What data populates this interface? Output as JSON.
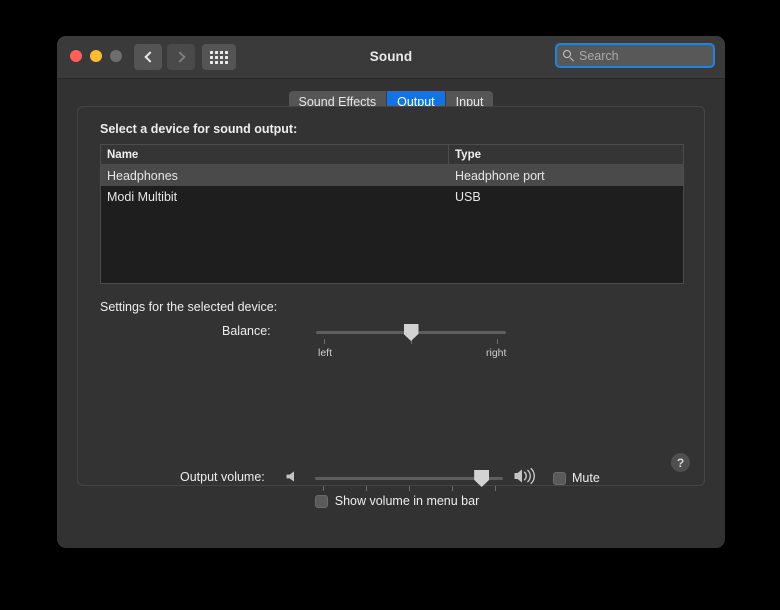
{
  "window": {
    "title": "Sound",
    "traffic_lights": [
      "close",
      "minimize",
      "zoom"
    ],
    "nav_back": "back-chevron",
    "nav_forward": "forward-chevron",
    "grid_button": "show-all-icon"
  },
  "search": {
    "placeholder": "Search",
    "value": "",
    "icon": "search-icon",
    "focus_color": "#1f84e0"
  },
  "tabs": [
    {
      "label": "Sound Effects",
      "active": false
    },
    {
      "label": "Output",
      "active": true
    },
    {
      "label": "Input",
      "active": false
    }
  ],
  "accent_color": "#1273e4",
  "device_section": {
    "label": "Select a device for sound output:",
    "columns": [
      "Name",
      "Type"
    ],
    "rows": [
      {
        "name": "Headphones",
        "type": "Headphone port",
        "selected": true
      },
      {
        "name": "Modi Multibit",
        "type": "USB",
        "selected": false
      }
    ]
  },
  "settings_section": {
    "label": "Settings for the selected device:",
    "balance": {
      "label": "Balance:",
      "left_label": "left",
      "right_label": "right",
      "value_percent": 50
    },
    "help_button": "?"
  },
  "output_volume": {
    "label": "Output volume:",
    "low_icon": "speaker-low-icon",
    "high_icon": "speaker-high-icon",
    "value_percent": 92,
    "mute": {
      "label": "Mute",
      "checked": false
    }
  },
  "menu_bar_option": {
    "label": "Show volume in menu bar",
    "checked": false
  }
}
